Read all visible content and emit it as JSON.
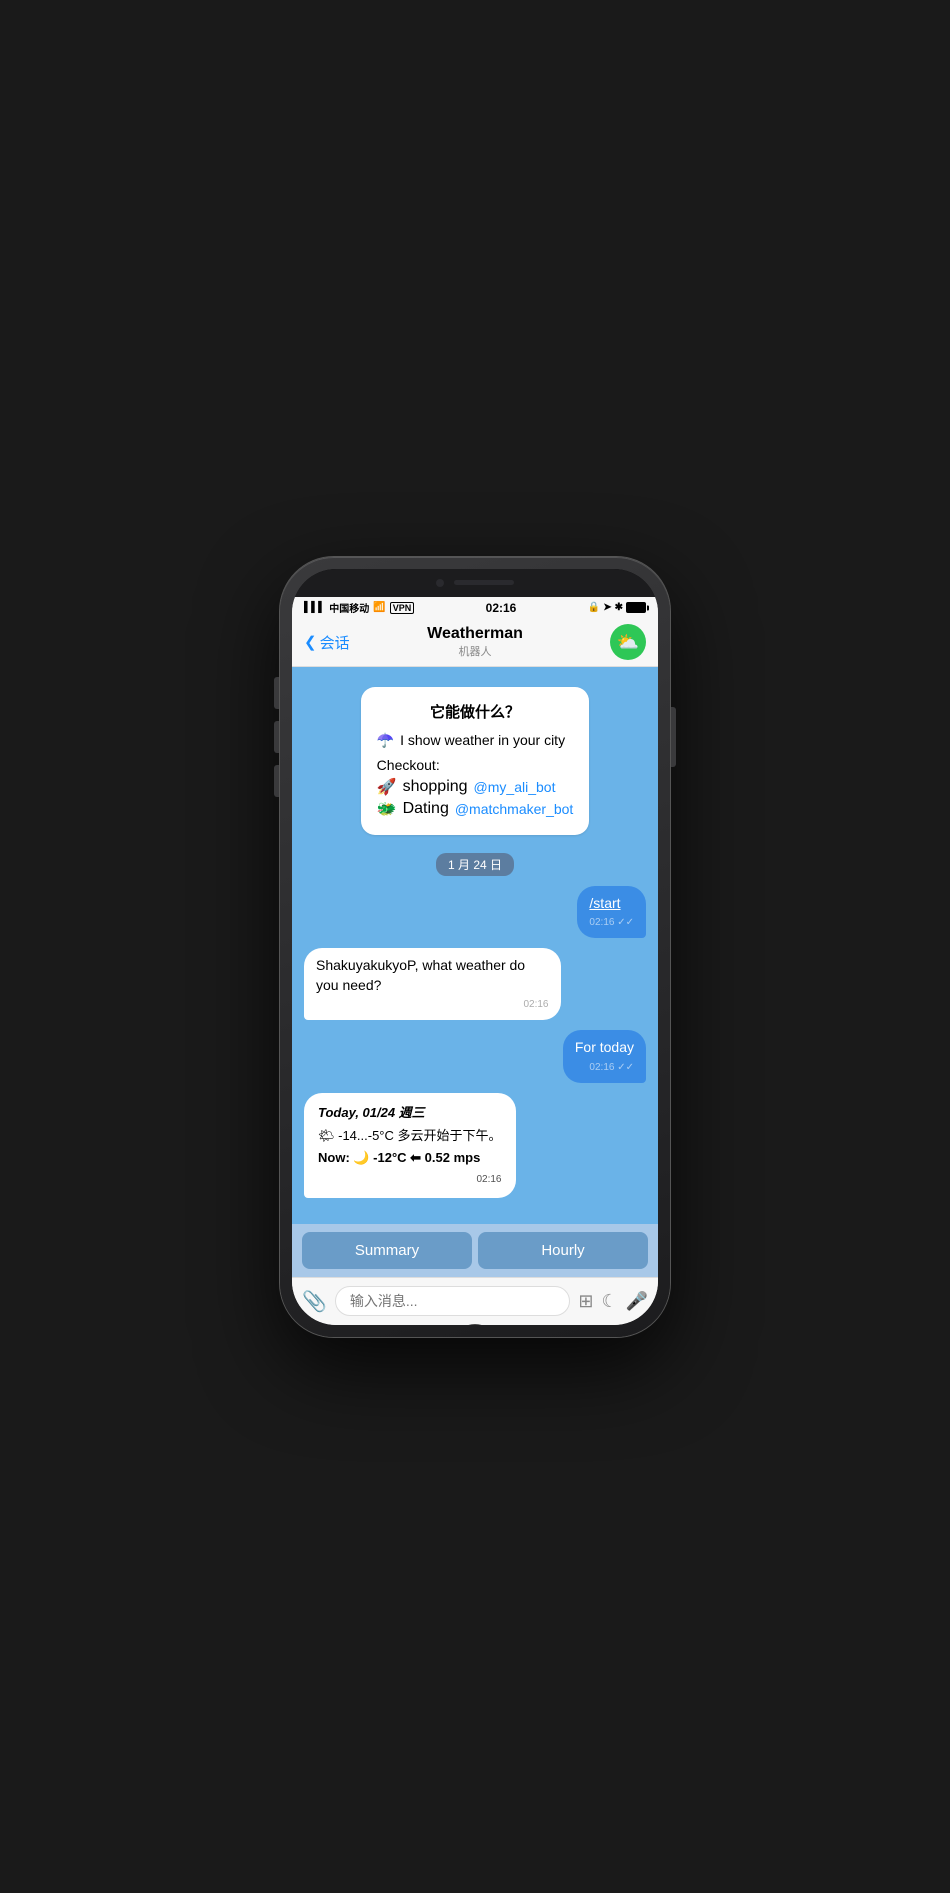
{
  "status_bar": {
    "carrier": "中国移动",
    "wifi": "WiFi",
    "vpn": "VPN",
    "time": "02:16",
    "lock_icon": "🔒",
    "location_icon": "➤",
    "bluetooth_icon": "✱"
  },
  "nav": {
    "back_label": "会话",
    "title": "Weatherman",
    "subtitle": "机器人",
    "avatar_emoji": "⛅"
  },
  "welcome": {
    "title": "它能做什么？",
    "line1_emoji": "☂️",
    "line1_text": "I show weather in your city",
    "checkout_label": "Checkout:",
    "ref1_emoji": "🚀",
    "ref1_text": "shopping",
    "ref1_link": "@my_ali_bot",
    "ref2_emoji": "🐲",
    "ref2_text": "Dating",
    "ref2_link": "@matchmaker_bot"
  },
  "date_separator": "1 月 24 日",
  "messages": [
    {
      "id": "msg1",
      "type": "outgoing",
      "text": "/start",
      "time": "02:16",
      "read": true
    },
    {
      "id": "msg2",
      "type": "incoming",
      "text": "ShakuyakukyoP, what weather do you need?",
      "time": "02:16"
    },
    {
      "id": "msg3",
      "type": "outgoing",
      "text": "For today",
      "time": "02:16",
      "read": true
    },
    {
      "id": "msg4",
      "type": "incoming_weather",
      "date_line": "Today, 01/24 週三",
      "temp_line": "🌤 -14...-5°C 多云开始于下午。",
      "now_line": "Now: 🌙 -12°C ⬅ 0.52 mps",
      "time": "02:16"
    }
  ],
  "action_buttons": [
    {
      "id": "btn-summary",
      "label": "Summary"
    },
    {
      "id": "btn-hourly",
      "label": "Hourly"
    }
  ],
  "input_bar": {
    "placeholder": "输入消息..."
  }
}
